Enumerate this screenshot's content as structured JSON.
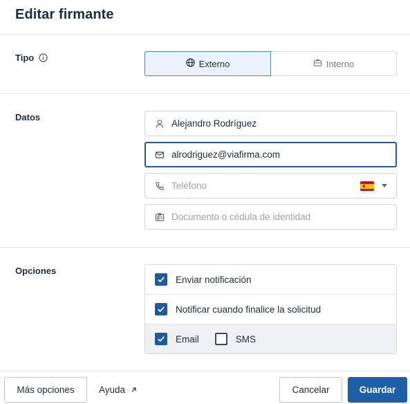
{
  "dialog": {
    "title": "Editar firmante"
  },
  "tipo": {
    "label": "Tipo",
    "info_icon": "info-circle-icon",
    "options": [
      {
        "label": "Externo",
        "icon": "globe-icon",
        "selected": true
      },
      {
        "label": "Interno",
        "icon": "briefcase-icon",
        "selected": false
      }
    ]
  },
  "datos": {
    "label": "Datos",
    "name": {
      "value": "Alejandro Rodríguez",
      "icon": "user-icon"
    },
    "email": {
      "value": "alrodriguez@viafirma.com",
      "icon": "mail-icon"
    },
    "phone": {
      "placeholder": "Teléfono",
      "icon": "phone-icon",
      "country_flag": "Spain"
    },
    "document": {
      "placeholder": "Documento o cédula de identidad",
      "icon": "id-card-icon"
    }
  },
  "opciones": {
    "label": "Opciones",
    "send_notification": {
      "label": "Enviar notificación",
      "checked": true
    },
    "notify_finish": {
      "label": "Notificar cuando finalice la solicitud",
      "checked": true
    },
    "email": {
      "label": "Email",
      "checked": true
    },
    "sms": {
      "label": "SMS",
      "checked": false
    }
  },
  "footer": {
    "more_options": "Más opciones",
    "help": "Ayuda",
    "cancel": "Cancelar",
    "save": "Guardar"
  },
  "colors": {
    "primary": "#1f5fa8",
    "checkbox": "#1f5a9a",
    "selected_bg": "#eaf2fb"
  }
}
